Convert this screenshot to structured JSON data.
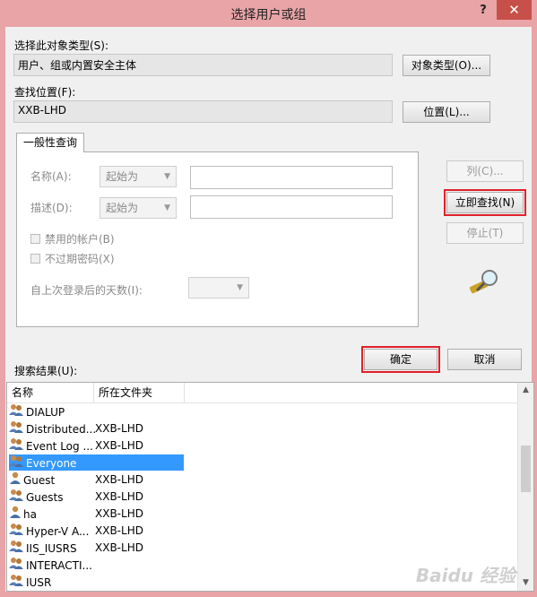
{
  "window": {
    "title": "选择用户或组",
    "help_label": "?",
    "close_label": "✕"
  },
  "object_type": {
    "label": "选择此对象类型(S):",
    "value": "用户、组或内置安全主体",
    "button": "对象类型(O)..."
  },
  "location": {
    "label": "查找位置(F):",
    "value": "XXB-LHD",
    "button": "位置(L)..."
  },
  "query": {
    "tab_label": "一般性查询",
    "name_label": "名称(A):",
    "name_mode": "起始为",
    "desc_label": "描述(D):",
    "desc_mode": "起始为",
    "disabled_accounts_label": "禁用的帐户(B)",
    "no_expire_label": "不过期密码(X)",
    "days_label": "自上次登录后的天数(I):"
  },
  "side_buttons": {
    "columns": "列(C)...",
    "find_now": "立即查找(N)",
    "stop": "停止(T)"
  },
  "actions": {
    "ok": "确定",
    "cancel": "取消"
  },
  "results": {
    "label": "搜索结果(U):",
    "columns": [
      "名称",
      "所在文件夹"
    ],
    "rows": [
      {
        "name": "DIALUP",
        "folder": "",
        "icon": "group-icon"
      },
      {
        "name": "Distributed...",
        "folder": "XXB-LHD",
        "icon": "group-icon"
      },
      {
        "name": "Event Log ...",
        "folder": "XXB-LHD",
        "icon": "group-icon"
      },
      {
        "name": "Everyone",
        "folder": "",
        "icon": "group-icon",
        "selected": true
      },
      {
        "name": "Guest",
        "folder": "XXB-LHD",
        "icon": "user-icon"
      },
      {
        "name": "Guests",
        "folder": "XXB-LHD",
        "icon": "group-icon"
      },
      {
        "name": "ha",
        "folder": "XXB-LHD",
        "icon": "user-icon"
      },
      {
        "name": "Hyper-V A...",
        "folder": "XXB-LHD",
        "icon": "group-icon"
      },
      {
        "name": "IIS_IUSRS",
        "folder": "XXB-LHD",
        "icon": "group-icon"
      },
      {
        "name": "INTERACTI...",
        "folder": "",
        "icon": "group-icon"
      },
      {
        "name": "IUSR",
        "folder": "",
        "icon": "group-icon"
      }
    ]
  },
  "watermark": "Baidu 经验",
  "colors": {
    "titlebar": "#e9a4a7",
    "close": "#c7504a",
    "selection": "#3399ff",
    "highlight_frame": "#e0212b"
  }
}
